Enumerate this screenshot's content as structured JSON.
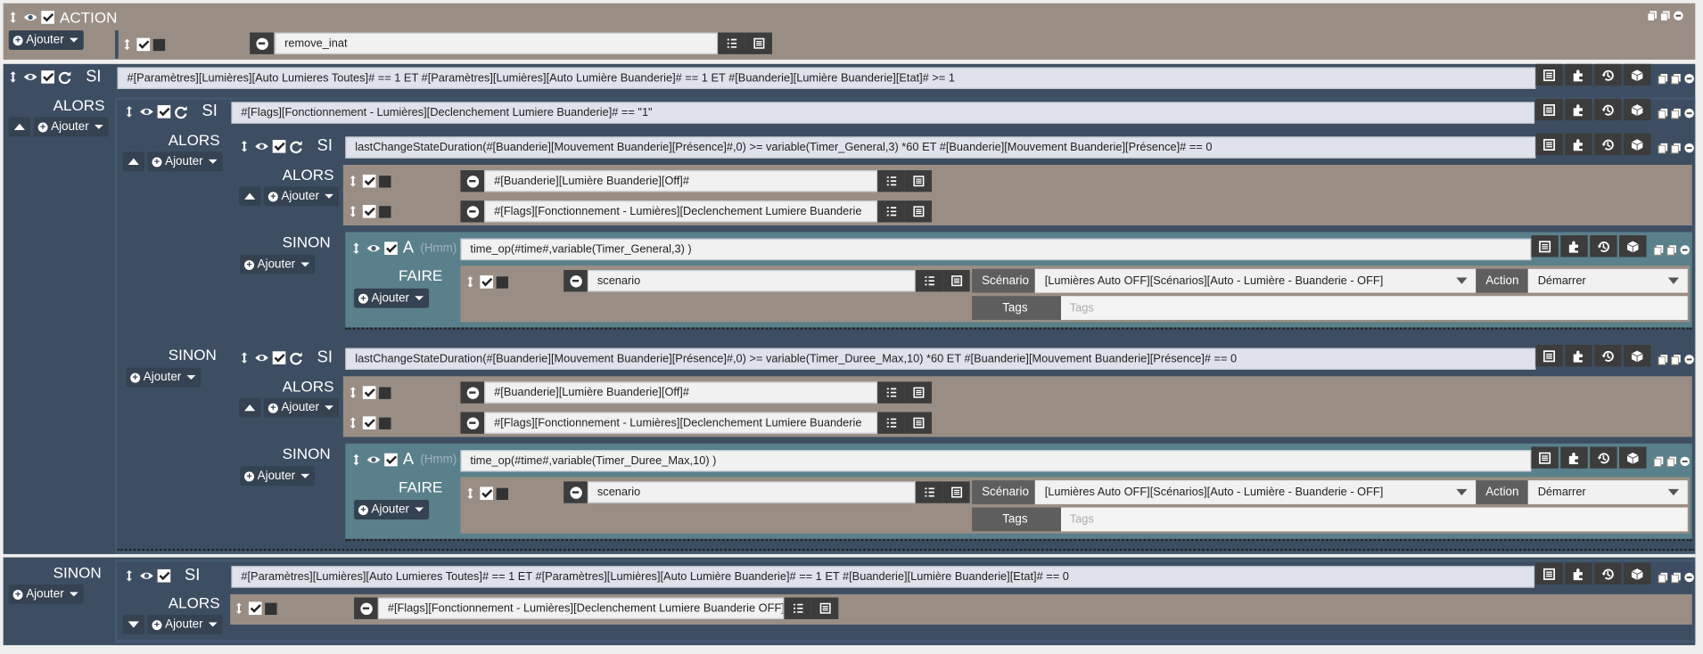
{
  "top": {
    "title": "ACTION",
    "add_label": "Ajouter",
    "item_value": "remove_inat"
  },
  "keywords": {
    "si": "SI",
    "alors": "ALORS",
    "sinon": "SINON",
    "a": "A",
    "hmm": "(Hmm)",
    "faire": "FAIRE",
    "add": "Ajouter"
  },
  "blocks": {
    "si1_condition": "#[Paramètres][Lumières][Auto Lumieres Toutes]# == 1 ET #[Paramètres][Lumières][Auto Lumière Buanderie]# == 1  ET #[Buanderie][Lumière Buanderie][Etat]# >= 1",
    "si2_condition": "#[Flags][Fonctionnement - Lumières][Declenchement Lumiere Buanderie]# == \"1\"",
    "si3_condition": "lastChangeStateDuration(#[Buanderie][Mouvement Buanderie][Présence]#,0) >= variable(Timer_General,3) *60 ET #[Buanderie][Mouvement Buanderie][Présence]# == 0",
    "si3_actions": [
      "#[Buanderie][Lumière Buanderie][Off]#",
      "#[Flags][Fonctionnement - Lumières][Declenchement Lumiere Buanderie"
    ],
    "a1_expr": "time_op(#time#,variable(Timer_General,3) )",
    "si4_condition": "lastChangeStateDuration(#[Buanderie][Mouvement Buanderie][Présence]#,0) >= variable(Timer_Duree_Max,10) *60 ET #[Buanderie][Mouvement Buanderie][Présence]# == 0",
    "si4_actions": [
      "#[Buanderie][Lumière Buanderie][Off]#",
      "#[Flags][Fonctionnement - Lumières][Declenchement Lumiere Buanderie"
    ],
    "a2_expr": "time_op(#time#,variable(Timer_Duree_Max,10) )",
    "si5_condition": "#[Paramètres][Lumières][Auto Lumieres Toutes]# == 1 ET #[Paramètres][Lumières][Auto Lumière Buanderie]# == 1 ET #[Buanderie][Lumière Buanderie][Etat]# == 0",
    "si5_action": "#[Flags][Fonctionnement - Lumières][Declenchement Lumiere Buanderie OFF]#"
  },
  "scenario": {
    "cmd": "scenario",
    "scenario_label": "Scénario",
    "scenario_value": "[Lumières Auto OFF][Scénarios][Auto - Lumière - Buanderie - OFF]",
    "action_label": "Action",
    "action_value": "Démarrer",
    "tags_label": "Tags",
    "tags_placeholder": "Tags"
  },
  "colors": {
    "tan": "#9a8e84",
    "navy": "#3d4e62",
    "teal": "#5a808b",
    "field": "#dfe2ea"
  },
  "icons": [
    "arrows-v-icon",
    "eye-icon",
    "check-icon",
    "refresh-icon",
    "list-icon",
    "puzzle-icon",
    "history-icon",
    "cube-icon",
    "copy-icon",
    "minus-circle-icon",
    "plus-circle-icon",
    "caret-down-icon"
  ]
}
